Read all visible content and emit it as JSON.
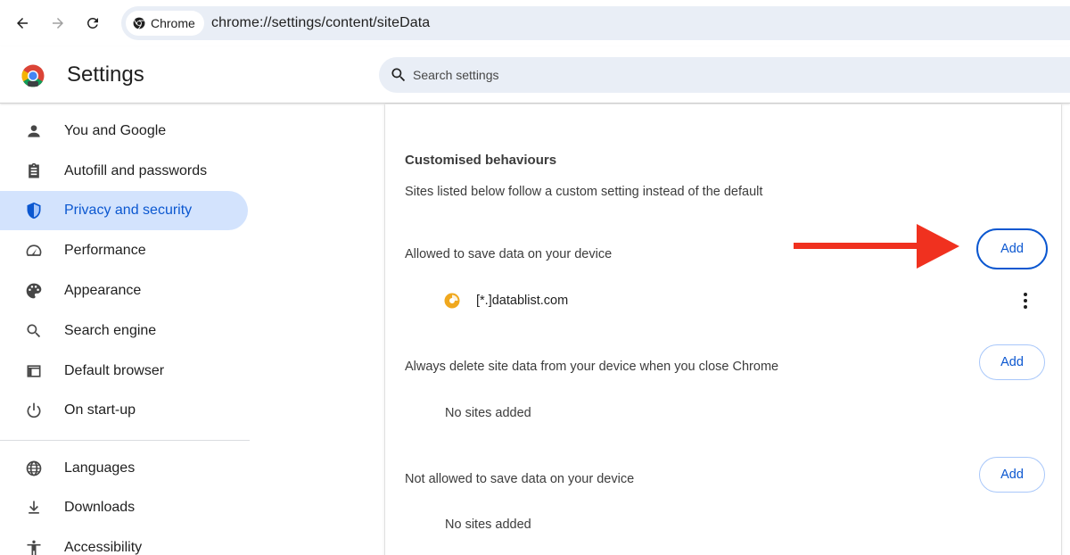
{
  "browser": {
    "back_icon": "arrow-back-icon",
    "forward_icon": "arrow-forward-icon",
    "reload_icon": "reload-icon",
    "chip_label": "Chrome",
    "url": "chrome://settings/content/siteData"
  },
  "header": {
    "title": "Settings",
    "search_placeholder": "Search settings"
  },
  "sidebar": {
    "items": [
      {
        "label": "You and Google",
        "icon": "person-icon",
        "active": false
      },
      {
        "label": "Autofill and passwords",
        "icon": "clipboard-icon",
        "active": false
      },
      {
        "label": "Privacy and security",
        "icon": "shield-icon",
        "active": true
      },
      {
        "label": "Performance",
        "icon": "speedometer-icon",
        "active": false
      },
      {
        "label": "Appearance",
        "icon": "palette-icon",
        "active": false
      },
      {
        "label": "Search engine",
        "icon": "search-icon",
        "active": false
      },
      {
        "label": "Default browser",
        "icon": "browser-window-icon",
        "active": false
      },
      {
        "label": "On start-up",
        "icon": "power-icon",
        "active": false
      },
      {
        "label": "Languages",
        "icon": "globe-icon",
        "active": false
      },
      {
        "label": "Downloads",
        "icon": "download-icon",
        "active": false
      },
      {
        "label": "Accessibility",
        "icon": "accessibility-icon",
        "active": false
      }
    ]
  },
  "content": {
    "section_title": "Customised behaviours",
    "section_desc": "Sites listed below follow a custom setting instead of the default",
    "groups": [
      {
        "label": "Allowed to save data on your device",
        "add_label": "Add",
        "sites": [
          "[*.]datablist.com"
        ]
      },
      {
        "label": "Always delete site data from your device when you close Chrome",
        "add_label": "Add",
        "empty": "No sites added"
      },
      {
        "label": "Not allowed to save data on your device",
        "add_label": "Add",
        "empty": "No sites added"
      }
    ]
  },
  "colors": {
    "accent": "#0b57d0",
    "active_bg": "#d3e3fd",
    "arrow": "#f0311f"
  }
}
